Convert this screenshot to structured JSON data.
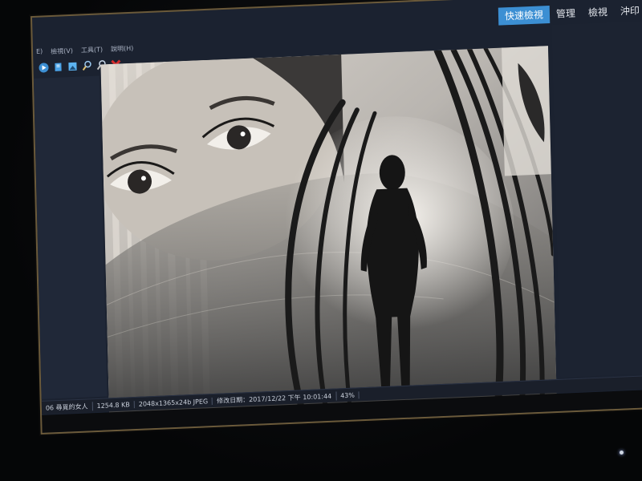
{
  "ribbon": {
    "tabs": [
      {
        "label": "快速檢視",
        "active": true
      },
      {
        "label": "管理",
        "active": false
      },
      {
        "label": "檢視",
        "active": false
      },
      {
        "label": "沖印",
        "active": false
      }
    ]
  },
  "menubar": {
    "items": [
      "E)",
      "檢視(V)",
      "工具(T)",
      "說明(H)"
    ]
  },
  "toolbar": {
    "icons": [
      "play-icon",
      "page-icon",
      "image-icon",
      "zoom-in-icon",
      "zoom-out-icon",
      "delete-icon"
    ]
  },
  "statusbar": {
    "filename": "06 尋覓的女人",
    "filesize": "1254.8 KB",
    "dimensions": "2048x1365x24b JPEG",
    "modified": "修改日期：2017/12/22 下午 10:01:44",
    "zoom": "43%"
  },
  "colors": {
    "accent": "#3c8fd3",
    "delete": "#d62b2b",
    "panel": "#1c2331"
  }
}
